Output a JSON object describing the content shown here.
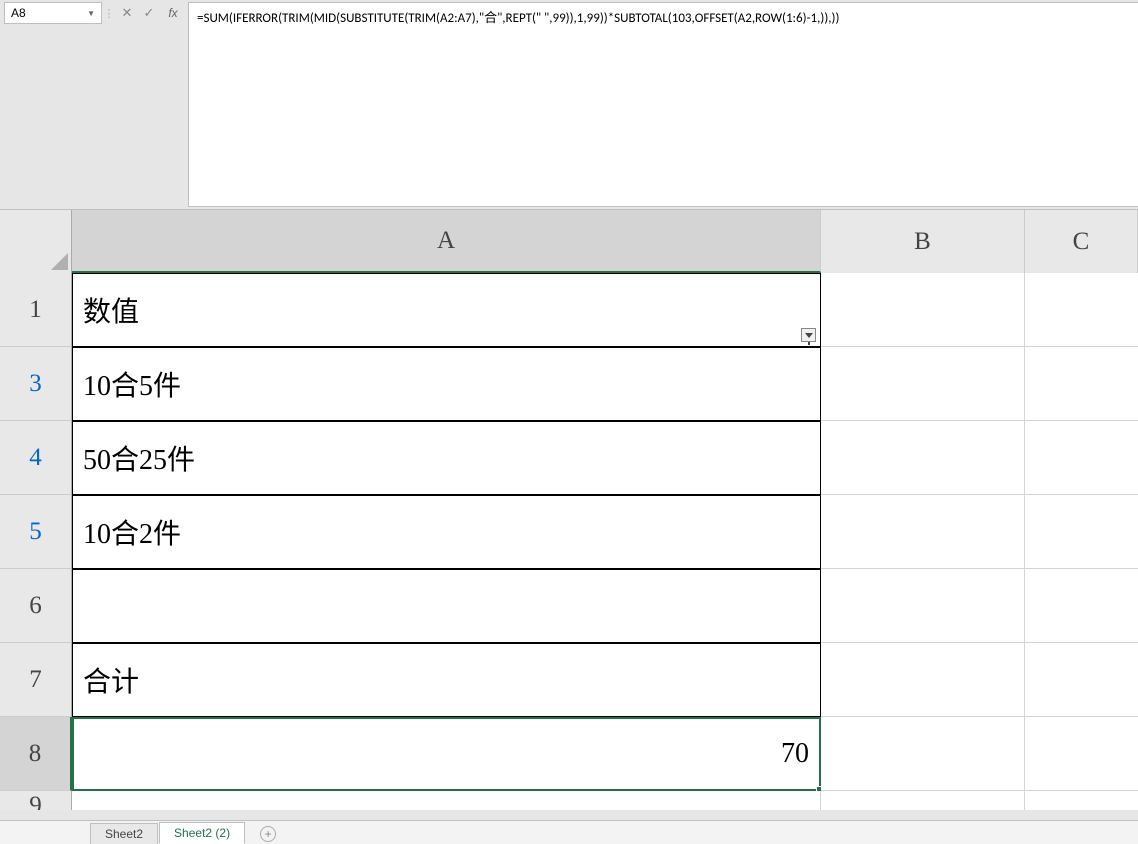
{
  "name_box": {
    "value": "A8"
  },
  "formula_bar": {
    "cancel": "✕",
    "enter": "✓",
    "fx": "fx",
    "formula": "=SUM(IFERROR(TRIM(MID(SUBSTITUTE(TRIM(A2:A7),\"合\",REPT(\" \",99)),1,99))*SUBTOTAL(103,OFFSET(A2,ROW(1:6)-1,)),))"
  },
  "columns": {
    "A": "A",
    "B": "B",
    "C": "C"
  },
  "rows": {
    "r1": {
      "num": "1",
      "A": "数值"
    },
    "r3": {
      "num": "3",
      "A": "10合5件"
    },
    "r4": {
      "num": "4",
      "A": "50合25件"
    },
    "r5": {
      "num": "5",
      "A": "10合2件"
    },
    "r6": {
      "num": "6",
      "A": ""
    },
    "r7": {
      "num": "7",
      "A": "合计"
    },
    "r8": {
      "num": "8",
      "A": "70"
    },
    "r9": {
      "num": "9",
      "A": ""
    }
  },
  "sheets": {
    "tab1": "Sheet2",
    "tab2": "Sheet2 (2)"
  }
}
